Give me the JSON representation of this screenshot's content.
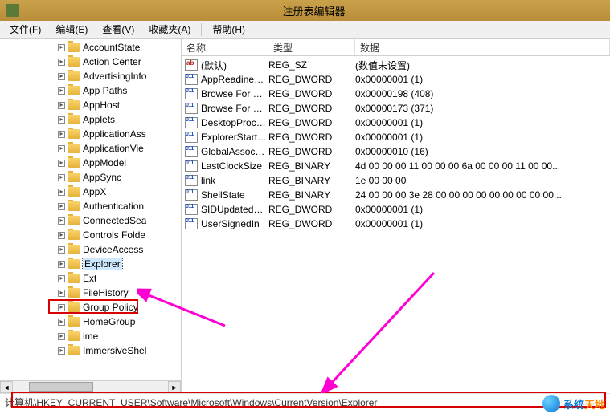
{
  "window": {
    "title": "注册表编辑器"
  },
  "menu": {
    "file": "文件(F)",
    "edit": "编辑(E)",
    "view": "查看(V)",
    "favorites": "收藏夹(A)",
    "help": "帮助(H)"
  },
  "tree": {
    "items": [
      {
        "label": "AccountState",
        "selected": false
      },
      {
        "label": "Action Center",
        "selected": false
      },
      {
        "label": "AdvertisingInfo",
        "selected": false
      },
      {
        "label": "App Paths",
        "selected": false
      },
      {
        "label": "AppHost",
        "selected": false
      },
      {
        "label": "Applets",
        "selected": false
      },
      {
        "label": "ApplicationAss",
        "selected": false
      },
      {
        "label": "ApplicationVie",
        "selected": false
      },
      {
        "label": "AppModel",
        "selected": false
      },
      {
        "label": "AppSync",
        "selected": false
      },
      {
        "label": "AppX",
        "selected": false
      },
      {
        "label": "Authentication",
        "selected": false
      },
      {
        "label": "ConnectedSea",
        "selected": false
      },
      {
        "label": "Controls Folde",
        "selected": false
      },
      {
        "label": "DeviceAccess",
        "selected": false
      },
      {
        "label": "Explorer",
        "selected": true
      },
      {
        "label": "Ext",
        "selected": false
      },
      {
        "label": "FileHistory",
        "selected": false
      },
      {
        "label": "Group Policy",
        "selected": false
      },
      {
        "label": "HomeGroup",
        "selected": false
      },
      {
        "label": "ime",
        "selected": false
      },
      {
        "label": "ImmersiveShel",
        "selected": false
      }
    ]
  },
  "list": {
    "headers": {
      "name": "名称",
      "type": "类型",
      "data": "数据"
    },
    "rows": [
      {
        "icon": "ab",
        "name": "(默认)",
        "type": "REG_SZ",
        "data": "(数值未设置)"
      },
      {
        "icon": "bin",
        "name": "AppReadiness...",
        "type": "REG_DWORD",
        "data": "0x00000001 (1)"
      },
      {
        "icon": "bin",
        "name": "Browse For Fol...",
        "type": "REG_DWORD",
        "data": "0x00000198 (408)"
      },
      {
        "icon": "bin",
        "name": "Browse For Fol...",
        "type": "REG_DWORD",
        "data": "0x00000173 (371)"
      },
      {
        "icon": "bin",
        "name": "DesktopProcess",
        "type": "REG_DWORD",
        "data": "0x00000001 (1)"
      },
      {
        "icon": "bin",
        "name": "ExplorerStartu...",
        "type": "REG_DWORD",
        "data": "0x00000001 (1)"
      },
      {
        "icon": "bin",
        "name": "GlobalAssocCh...",
        "type": "REG_DWORD",
        "data": "0x00000010 (16)"
      },
      {
        "icon": "bin",
        "name": "LastClockSize",
        "type": "REG_BINARY",
        "data": "4d 00 00 00 11 00 00 00 6a 00 00 00 11 00 00..."
      },
      {
        "icon": "bin",
        "name": "link",
        "type": "REG_BINARY",
        "data": "1e 00 00 00"
      },
      {
        "icon": "bin",
        "name": "ShellState",
        "type": "REG_BINARY",
        "data": "24 00 00 00 3e 28 00 00 00 00 00 00 00 00 00..."
      },
      {
        "icon": "bin",
        "name": "SIDUpdatedO...",
        "type": "REG_DWORD",
        "data": "0x00000001 (1)"
      },
      {
        "icon": "bin",
        "name": "UserSignedIn",
        "type": "REG_DWORD",
        "data": "0x00000001 (1)"
      }
    ]
  },
  "status": {
    "path": "计算机\\HKEY_CURRENT_USER\\Software\\Microsoft\\Windows\\CurrentVersion\\Explorer"
  },
  "watermark": {
    "t1": "系统",
    "t2": "天地"
  }
}
